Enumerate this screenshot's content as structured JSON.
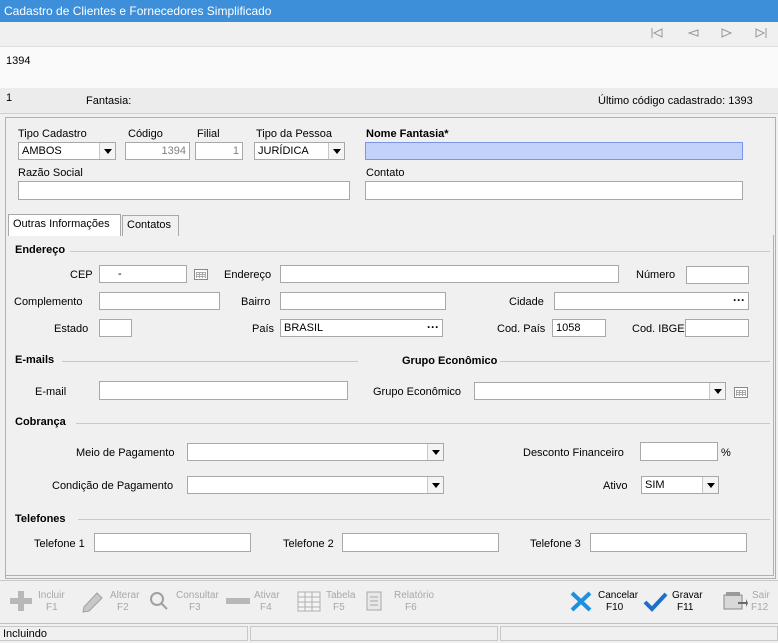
{
  "window": {
    "title": "Cadastro de Clientes e Fornecedores Simplificado"
  },
  "nav": {
    "first": "first-icon",
    "prev": "prev-icon",
    "next": "next-icon",
    "last": "last-icon"
  },
  "header": {
    "code": "1394",
    "record_index": "1",
    "fantasia_label": "Fantasia:",
    "last_code": "Último código cadastrado: 1393"
  },
  "form": {
    "tipo_cadastro": {
      "label": "Tipo Cadastro",
      "value": "AMBOS"
    },
    "codigo": {
      "label": "Código",
      "value": "1394"
    },
    "filial": {
      "label": "Filial",
      "value": "1"
    },
    "tipo_pessoa": {
      "label": "Tipo da Pessoa",
      "value": "JURÍDICA"
    },
    "nome_fantasia": {
      "label": "Nome Fantasia*",
      "value": ""
    },
    "razao_social": {
      "label": "Razão Social",
      "value": ""
    },
    "contato": {
      "label": "Contato",
      "value": ""
    }
  },
  "tabs": [
    {
      "label": "Outras Informações",
      "active": true
    },
    {
      "label": "Contatos",
      "active": false
    }
  ],
  "endereco": {
    "section": "Endereço",
    "cep": {
      "label": "CEP",
      "value": "-"
    },
    "endereco": {
      "label": "Endereço",
      "value": ""
    },
    "numero": {
      "label": "Número",
      "value": ""
    },
    "complemento": {
      "label": "Complemento",
      "value": ""
    },
    "bairro": {
      "label": "Bairro",
      "value": ""
    },
    "cidade": {
      "label": "Cidade",
      "value": ""
    },
    "estado": {
      "label": "Estado",
      "value": ""
    },
    "pais": {
      "label": "País",
      "value": "BRASIL"
    },
    "cod_pais": {
      "label": "Cod. País",
      "value": "1058"
    },
    "cod_ibge": {
      "label": "Cod. IBGE",
      "value": ""
    }
  },
  "emails": {
    "section": "E-mails",
    "email": {
      "label": "E-mail",
      "value": ""
    }
  },
  "grupo": {
    "section": "Grupo Econômico",
    "grupo": {
      "label": "Grupo Econômico",
      "value": ""
    }
  },
  "cobranca": {
    "section": "Cobrança",
    "meio_pagamento": {
      "label": "Meio de Pagamento",
      "value": ""
    },
    "desconto": {
      "label": "Desconto Financeiro",
      "value": "",
      "unit": "%"
    },
    "condicao": {
      "label": "Condição de Pagamento",
      "value": ""
    },
    "ativo": {
      "label": "Ativo",
      "value": "SIM"
    }
  },
  "telefones": {
    "section": "Telefones",
    "t1": {
      "label": "Telefone 1",
      "value": ""
    },
    "t2": {
      "label": "Telefone 2",
      "value": ""
    },
    "t3": {
      "label": "Telefone 3",
      "value": ""
    }
  },
  "toolbar": {
    "incluir": {
      "label": "Incluir",
      "key": "F1"
    },
    "alterar": {
      "label": "Alterar",
      "key": "F2"
    },
    "consultar": {
      "label": "Consultar",
      "key": "F3"
    },
    "ativar": {
      "label": "Ativar",
      "key": "F4"
    },
    "tabela": {
      "label": "Tabela",
      "key": "F5"
    },
    "relatorio": {
      "label": "Relatório",
      "key": "F6"
    },
    "cancelar": {
      "label": "Cancelar",
      "key": "F10"
    },
    "gravar": {
      "label": "Gravar",
      "key": "F11"
    },
    "sair": {
      "label": "Sair",
      "key": "F12"
    }
  },
  "status": {
    "mode": "Incluindo"
  },
  "colors": {
    "titlebar": "#3c8fd8",
    "highlight_field": "#c2d2fb",
    "cancel_icon": "#1e90e0",
    "save_icon": "#1a6fd0"
  }
}
